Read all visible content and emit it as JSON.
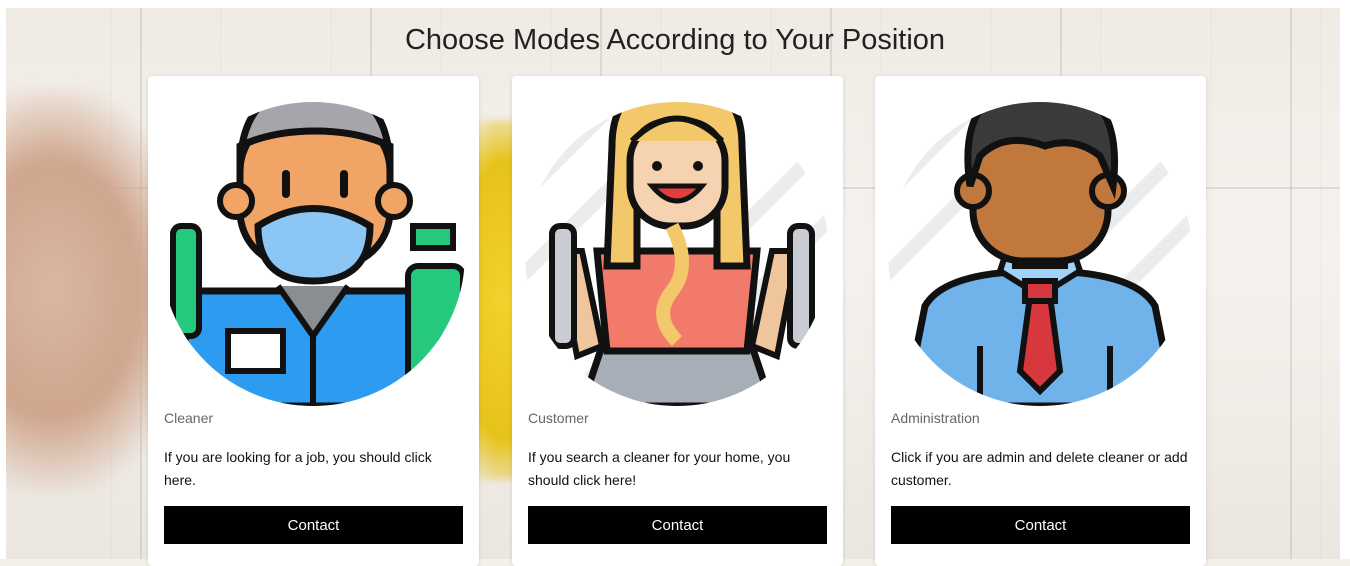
{
  "page": {
    "title": "Choose Modes According to Your Position"
  },
  "cards": [
    {
      "role": "Cleaner",
      "description": "If you are looking for a job, you should click here.",
      "button": "Contact",
      "icon": "cleaner-icon"
    },
    {
      "role": "Customer",
      "description": "If you search a cleaner for your home, you should click here!",
      "button": "Contact",
      "icon": "customer-icon"
    },
    {
      "role": "Administration",
      "description": "Click if you are admin and delete cleaner or add customer.",
      "button": "Contact",
      "icon": "admin-icon"
    }
  ],
  "colors": {
    "button": "#000000",
    "button_text": "#ffffff",
    "card": "#ffffff"
  }
}
